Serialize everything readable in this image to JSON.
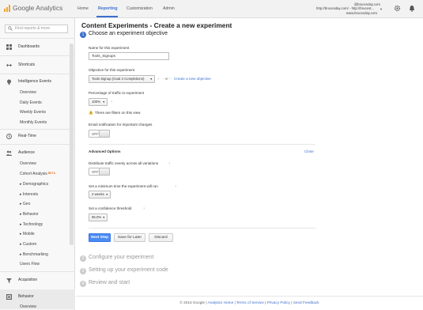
{
  "header": {
    "brand": "Google Analytics",
    "nav": [
      "Home",
      "Reporting",
      "Customization",
      "Admin"
    ],
    "account": {
      "email": "@brucesday.com",
      "site": "http://brucesday.com/ - http://brucest...",
      "view": "www.brucesday.com"
    }
  },
  "sidebar": {
    "search_placeholder": "Find reports & more",
    "dashboards": "Dashboards",
    "shortcuts": "Shortcuts",
    "intelligence": "Intelligence Events",
    "intelligence_sub": [
      "Overview",
      "Daily Events",
      "Weekly Events",
      "Monthly Events"
    ],
    "realtime": "Real-Time",
    "audience": "Audience",
    "audience_sub": [
      "Overview",
      "Cohort Analysis"
    ],
    "new_badge": "BETA",
    "audience_groups": [
      "Demographics",
      "Interests",
      "Geo",
      "Behavior",
      "Technology",
      "Mobile",
      "Custom",
      "Benchmarking"
    ],
    "users_flow": "Users Flow",
    "acquisition": "Acquisition",
    "behavior": "Behavior",
    "behavior_sub": "Overview"
  },
  "main": {
    "page_title": "Content Experiments - Create a new experiment",
    "steps": [
      {
        "num": "1",
        "label": "Choose an experiment objective"
      },
      {
        "num": "2",
        "label": "Configure your experiment"
      },
      {
        "num": "3",
        "label": "Setting up your experiment code"
      },
      {
        "num": "4",
        "label": "Review and start"
      }
    ],
    "name_label": "Name for this experiment",
    "name_value": "Tools_Signups",
    "objective_label": "Objective for this experiment",
    "objective_value": "Tools Signup (Goal 3 Completions)",
    "or_text": "- or -",
    "create_objective": "Create a new objective",
    "traffic_label": "Percentage of traffic to experiment",
    "traffic_value": "100%",
    "filters_warning": "There are filters on this view",
    "email_label": "Email notification for important changes",
    "toggle_off": "OFF",
    "advanced_label": "Advanced Options",
    "close_link": "Close",
    "distribute_label": "Distribute traffic evenly across all variations",
    "min_time_label": "Set a minimum time the experiment will run",
    "min_time_value": "2 weeks",
    "confidence_label": "Set a confidence threshold",
    "confidence_value": "95.0%",
    "buttons": {
      "next": "Next Step",
      "save": "Save for Later",
      "discard": "Discard"
    }
  },
  "footer": {
    "copyright": "© 2015 Google",
    "links": [
      "Analytics Home",
      "Terms of Service",
      "Privacy Policy",
      "Send Feedback"
    ],
    "sep": "|"
  },
  "colors": {
    "accent": "#3d6fce",
    "primary_button": "#4a8af4",
    "logo": "#f4a52b",
    "warning": "#f1c232"
  }
}
